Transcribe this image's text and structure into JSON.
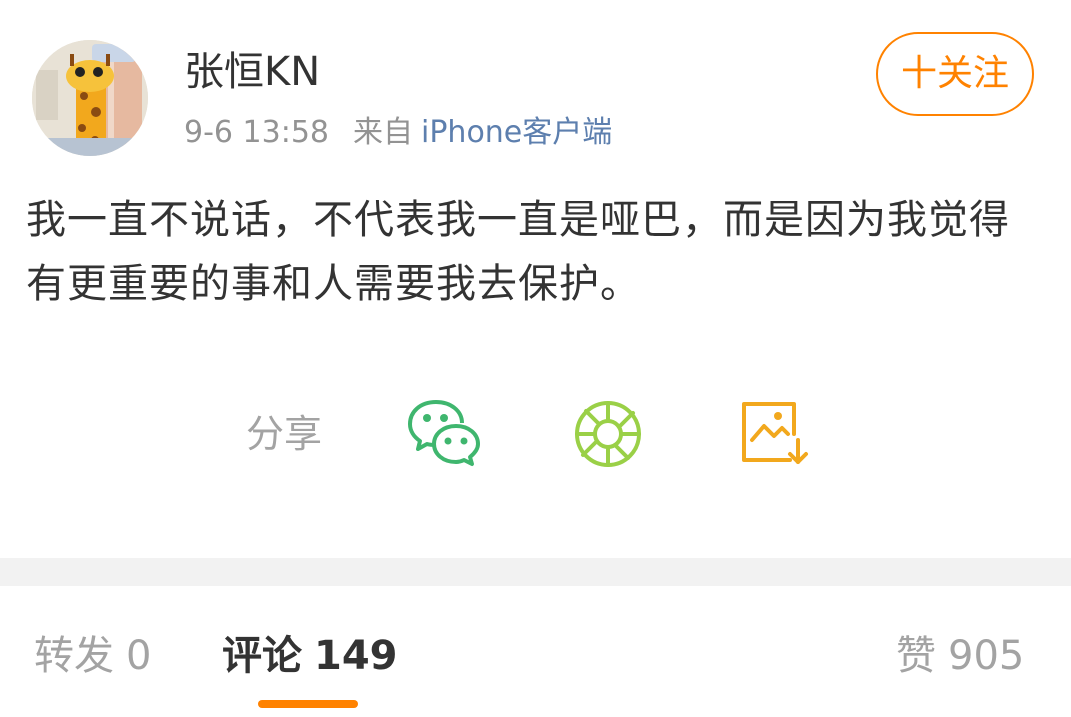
{
  "post": {
    "username": "张恒KN",
    "date": "9-6 13:58",
    "source_label": "来自",
    "source_client": "iPhone客户端",
    "follow_label": "十关注",
    "content": "我一直不说话，不代表我一直是哑巴，而是因为我觉得有更重要的事和人需要我去保护。"
  },
  "share": {
    "label": "分享",
    "icons": [
      "wechat-icon",
      "moments-icon",
      "save-image-icon"
    ]
  },
  "tabs": {
    "repost_label": "转发",
    "repost_count": "0",
    "comment_label": "评论",
    "comment_count": "149",
    "like_label": "赞",
    "like_count": "905"
  },
  "colors": {
    "accent": "#ff8200",
    "link": "#5d7fae",
    "wechat_green": "#3fb66e",
    "moments_green": "#9ad047",
    "muted": "#a3a3a3"
  }
}
